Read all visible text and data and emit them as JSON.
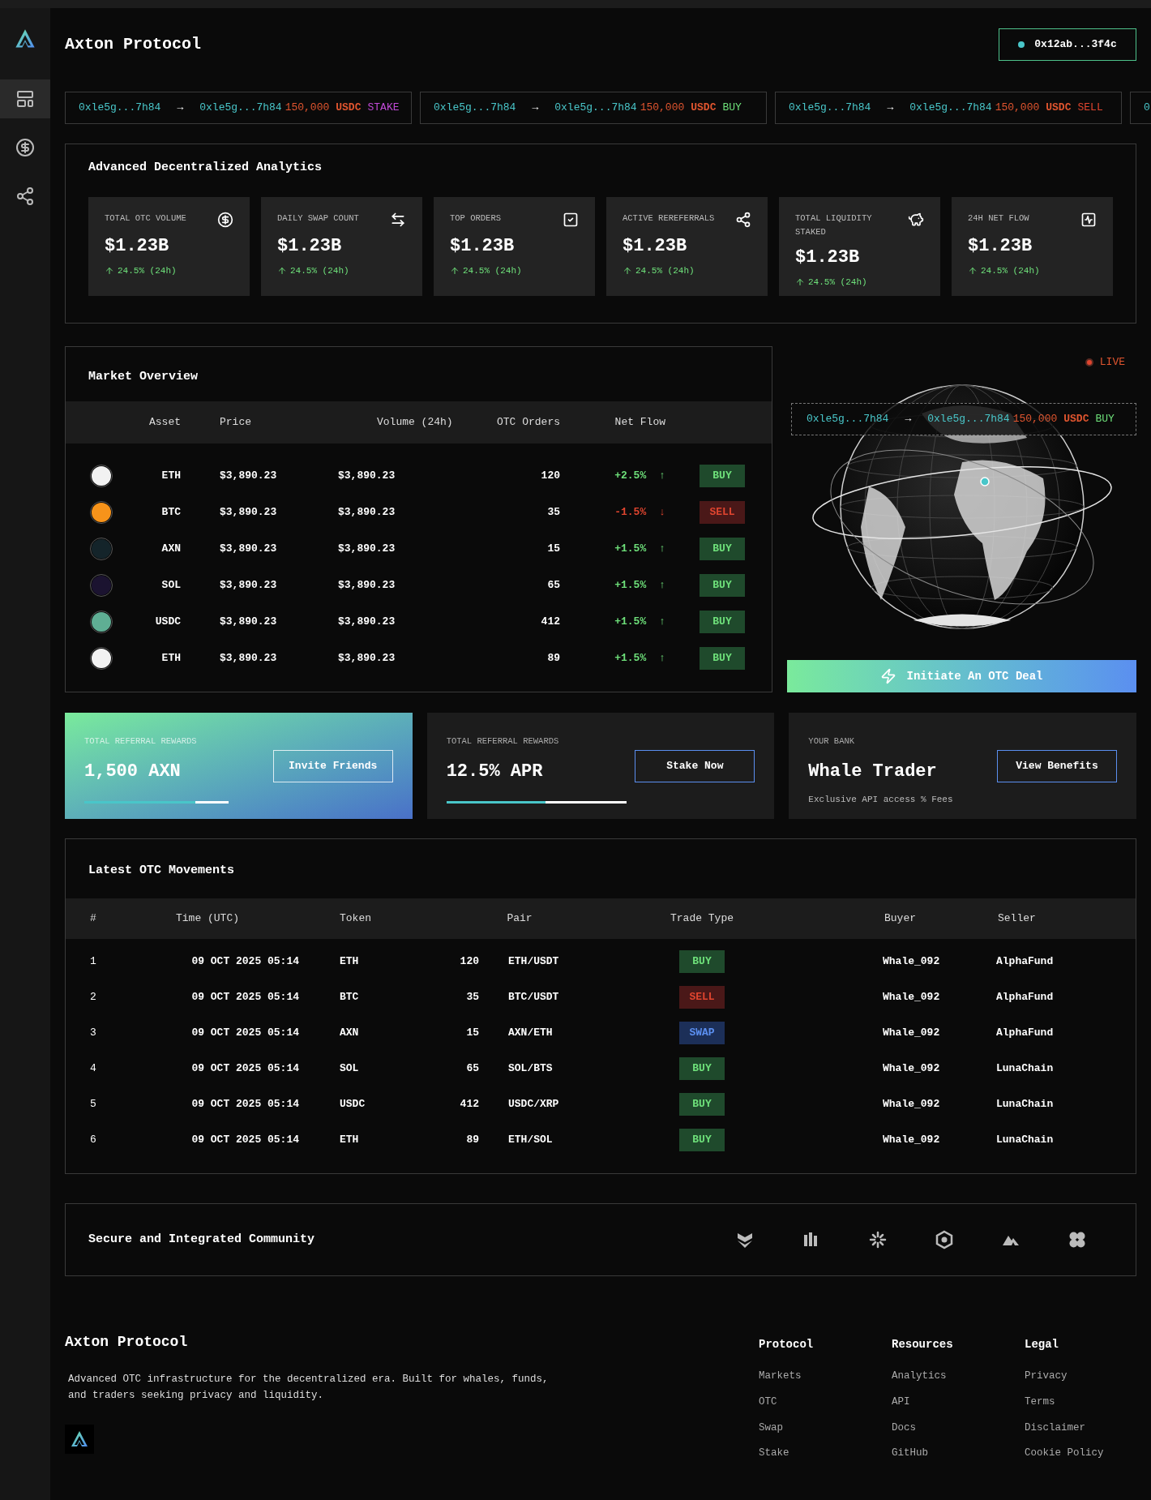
{
  "sidebar": {
    "items": [
      {
        "selected": true
      },
      {
        "selected": false
      },
      {
        "selected": false
      }
    ]
  },
  "header": {
    "title": "Axton Protocol",
    "wallet": "0x12ab...3f4c"
  },
  "ticker": [
    {
      "from": "0xle5g...7h84",
      "arrow": "→",
      "to": "0xle5g...7h84",
      "amount": "150,000",
      "token": "USDC",
      "action": "STAKE",
      "kind": "stake"
    },
    {
      "from": "0xle5g...7h84",
      "arrow": "→",
      "to": "0xle5g...7h84",
      "amount": "150,000",
      "token": "USDC",
      "action": "BUY",
      "kind": "buy"
    },
    {
      "from": "0xle5g...7h84",
      "arrow": "→",
      "to": "0xle5g...7h84",
      "amount": "150,000",
      "token": "USDC",
      "action": "SELL",
      "kind": "sell"
    },
    {
      "from": "0"
    }
  ],
  "analytics": {
    "title": "Advanced Decentralized Analytics",
    "stats": [
      {
        "label": "TOTAL OTC VOLUME",
        "value": "$1.23B",
        "change": "24.5% (24h)"
      },
      {
        "label": "DAILY SWAP COUNT",
        "value": "$1.23B",
        "change": "24.5% (24h)"
      },
      {
        "label": "TOP ORDERS",
        "value": "$1.23B",
        "change": "24.5% (24h)"
      },
      {
        "label": "ACTIVE REREFERRALS",
        "value": "$1.23B",
        "change": "24.5% (24h)"
      },
      {
        "label": "TOTAL LIQUIDITY STAKED",
        "value": "$1.23B",
        "change": "24.5% (24h)"
      },
      {
        "label": "24H NET FLOW",
        "value": "$1.23B",
        "change": "24.5% (24h)"
      }
    ]
  },
  "market": {
    "title": "Market Overview",
    "columns": [
      "Asset",
      "Price",
      "Volume (24h)",
      "OTC Orders",
      "Net Flow"
    ],
    "rows": [
      {
        "asset": "ETH",
        "color": "#f2f2f2",
        "price": "$3,890.23",
        "volume": "$3,890.23",
        "orders": "120",
        "flow": "+2.5%",
        "arrow": "↑",
        "action": "BUY",
        "kind": "buy"
      },
      {
        "asset": "BTC",
        "color": "#f7931a",
        "price": "$3,890.23",
        "volume": "$3,890.23",
        "orders": "35",
        "flow": "-1.5%",
        "arrow": "↓",
        "action": "SELL",
        "kind": "sell"
      },
      {
        "asset": "AXN",
        "color": "#14242a",
        "price": "$3,890.23",
        "volume": "$3,890.23",
        "orders": "15",
        "flow": "+1.5%",
        "arrow": "↑",
        "action": "BUY",
        "kind": "buy"
      },
      {
        "asset": "SOL",
        "color": "#1b1330",
        "price": "$3,890.23",
        "volume": "$3,890.23",
        "orders": "65",
        "flow": "+1.5%",
        "arrow": "↑",
        "action": "BUY",
        "kind": "buy"
      },
      {
        "asset": "USDC",
        "color": "#5fae94",
        "price": "$3,890.23",
        "volume": "$3,890.23",
        "orders": "412",
        "flow": "+1.5%",
        "arrow": "↑",
        "action": "BUY",
        "kind": "buy"
      },
      {
        "asset": "ETH",
        "color": "#f2f2f2",
        "price": "$3,890.23",
        "volume": "$3,890.23",
        "orders": "89",
        "flow": "+1.5%",
        "arrow": "↑",
        "action": "BUY",
        "kind": "buy"
      }
    ]
  },
  "globe": {
    "live": "LIVE",
    "transfer": {
      "from": "0xle5g...7h84",
      "arrow": "→",
      "to": "0xle5g...7h84",
      "amount": "150,000",
      "token": "USDC",
      "action": "BUY"
    },
    "cta": "Initiate An OTC Deal"
  },
  "cards": [
    {
      "kind": "gradient",
      "label": "TOTAL REFERRAL REWARDS",
      "value": "1,500 AXN",
      "button": "Invite Friends",
      "level": 0.77
    },
    {
      "kind": "dark",
      "label": "TOTAL REFERRAL REWARDS",
      "value": "12.5% APR",
      "button": "Stake Now",
      "level": 0.55
    },
    {
      "kind": "dark",
      "label": "YOUR BANK",
      "value": "Whale Trader",
      "button": "View Benefits",
      "note": "Exclusive API access % Fees"
    }
  ],
  "movements": {
    "title": "Latest OTC Movements",
    "columns": [
      "#",
      "Time (UTC)",
      "Token",
      "Pair",
      "Trade Type",
      "Buyer",
      "Seller"
    ],
    "rows": [
      {
        "n": "1",
        "time": "09 OCT 2025 05:14",
        "token": "ETH",
        "amount": "120",
        "pair": "ETH/USDT",
        "trade": "BUY",
        "kind": "buy",
        "buyer": "Whale_092",
        "seller": "AlphaFund"
      },
      {
        "n": "2",
        "time": "09 OCT 2025 05:14",
        "token": "BTC",
        "amount": "35",
        "pair": "BTC/USDT",
        "trade": "SELL",
        "kind": "sell",
        "buyer": "Whale_092",
        "seller": "AlphaFund"
      },
      {
        "n": "3",
        "time": "09 OCT 2025 05:14",
        "token": "AXN",
        "amount": "15",
        "pair": "AXN/ETH",
        "trade": "SWAP",
        "kind": "swap",
        "buyer": "Whale_092",
        "seller": "AlphaFund"
      },
      {
        "n": "4",
        "time": "09 OCT 2025 05:14",
        "token": "SOL",
        "amount": "65",
        "pair": "SOL/BTS",
        "trade": "BUY",
        "kind": "buy",
        "buyer": "Whale_092",
        "seller": "LunaChain"
      },
      {
        "n": "5",
        "time": "09 OCT 2025 05:14",
        "token": "USDC",
        "amount": "412",
        "pair": "USDC/XRP",
        "trade": "BUY",
        "kind": "buy",
        "buyer": "Whale_092",
        "seller": "LunaChain"
      },
      {
        "n": "6",
        "time": "09 OCT 2025 05:14",
        "token": "ETH",
        "amount": "89",
        "pair": "ETH/SOL",
        "trade": "BUY",
        "kind": "buy",
        "buyer": "Whale_092",
        "seller": "LunaChain"
      }
    ]
  },
  "community": {
    "title": "Secure and Integrated Community"
  },
  "footer": {
    "brand": "Axton Protocol",
    "description": "Advanced OTC infrastructure for the decentralized era. Built for whales, funds, and traders seeking privacy and liquidity.",
    "columns": [
      {
        "title": "Protocol",
        "links": [
          "Markets",
          "OTC",
          "Swap",
          "Stake"
        ]
      },
      {
        "title": "Resources",
        "links": [
          "Analytics",
          "API",
          "Docs",
          "GitHub"
        ]
      },
      {
        "title": "Legal",
        "links": [
          "Privacy",
          "Terms",
          "Disclaimer",
          "Cookie Policy"
        ]
      }
    ]
  }
}
